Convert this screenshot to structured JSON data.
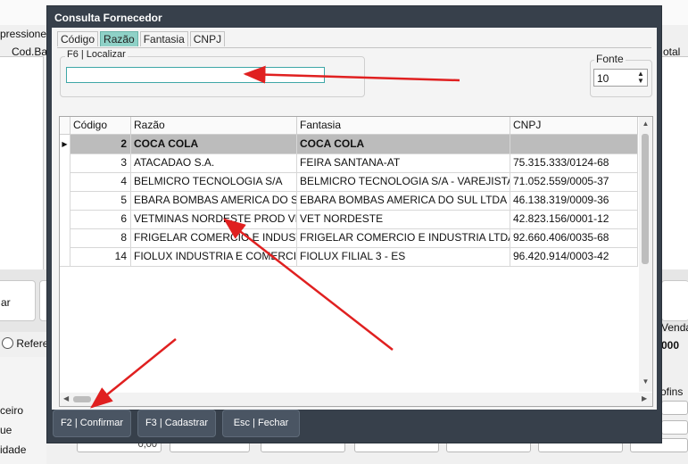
{
  "background": {
    "fragments": {
      "impressione": "pressione",
      "cod_ba": "Cod.Ba",
      "otal": "otal",
      "button_ar": "ar",
      "radio_refere": "Refere",
      "venda": "Venda",
      "zeros": "000",
      "ofins": "ofins",
      "ceiro": "ceiro",
      "ue": "ue",
      "idade": "idade",
      "input_value": "0,00"
    }
  },
  "dialog": {
    "title": "Consulta Fornecedor",
    "tabs": [
      {
        "label": "Código"
      },
      {
        "label": "Razão"
      },
      {
        "label": "Fantasia"
      },
      {
        "label": "CNPJ"
      }
    ],
    "active_tab": "Razão",
    "search": {
      "group_label": "F6 | Localizar",
      "value": ""
    },
    "fonte": {
      "label": "Fonte",
      "value": "10"
    },
    "grid": {
      "columns": [
        "Código",
        "Razão",
        "Fantasia",
        "CNPJ"
      ],
      "rows": [
        {
          "codigo": "2",
          "razao": "COCA COLA",
          "fantasia": "COCA COLA",
          "cnpj": ""
        },
        {
          "codigo": "3",
          "razao": "ATACADAO S.A.",
          "fantasia": "FEIRA SANTANA-AT",
          "cnpj": "75.315.333/0124-68"
        },
        {
          "codigo": "4",
          "razao": "BELMICRO TECNOLOGIA S/A",
          "fantasia": "BELMICRO TECNOLOGIA S/A - VAREJISTA",
          "cnpj": "71.052.559/0005-37"
        },
        {
          "codigo": "5",
          "razao": "EBARA BOMBAS AMERICA DO SUL",
          "fantasia": "EBARA BOMBAS AMERICA DO SUL LTDA - FILIAL",
          "cnpj": "46.138.319/0009-36"
        },
        {
          "codigo": "6",
          "razao": "VETMINAS NORDESTE PROD VET",
          "fantasia": "VET NORDESTE",
          "cnpj": "42.823.156/0001-12"
        },
        {
          "codigo": "8",
          "razao": "FRIGELAR COMERCIO E INDUSTRIA",
          "fantasia": "FRIGELAR COMERCIO E INDUSTRIA LTDA",
          "cnpj": "92.660.406/0035-68"
        },
        {
          "codigo": "14",
          "razao": "FIOLUX INDUSTRIA E COMERCIO",
          "fantasia": "FIOLUX FILIAL 3 - ES",
          "cnpj": "96.420.914/0003-42"
        }
      ],
      "selected_row": 0
    },
    "buttons": {
      "confirm": "F2 | Confirmar",
      "register": "F3 | Cadastrar",
      "close": "Esc | Fechar"
    }
  },
  "colors": {
    "dialog_frame": "#37404b",
    "active_tab": "#8fd1c7",
    "input_border": "#3fa7a7",
    "selected_row": "#bcbcbc",
    "button": "#4a5563",
    "annotation_arrow": "#e02020"
  }
}
